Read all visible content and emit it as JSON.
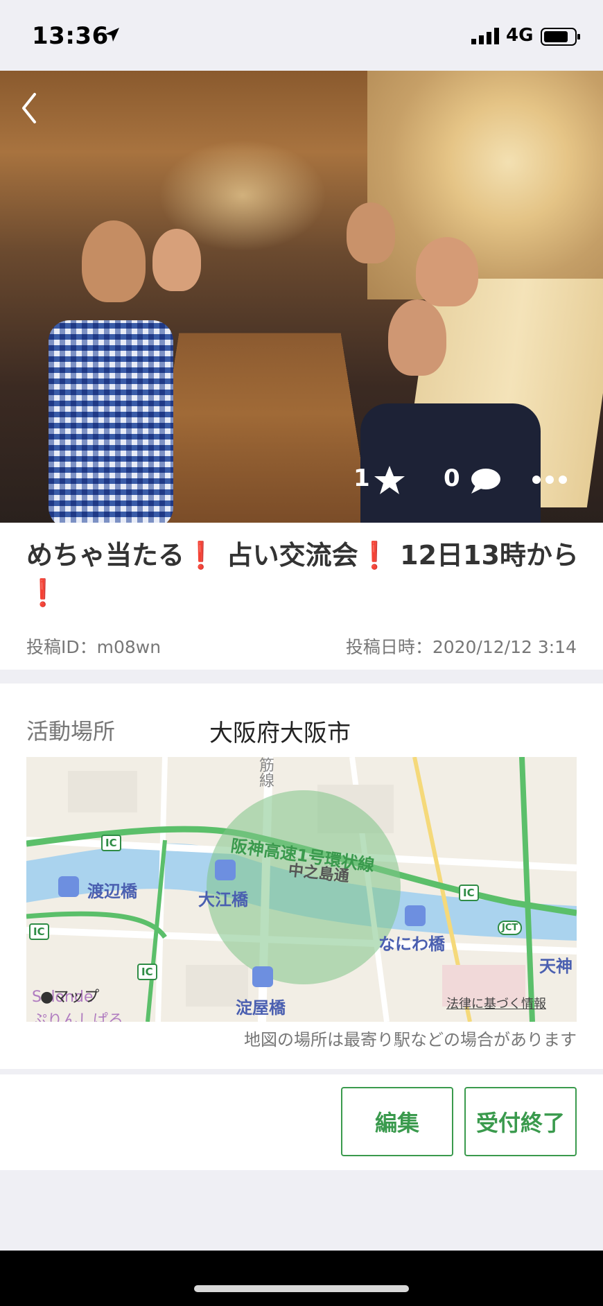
{
  "status": {
    "time": "13:36",
    "network": "4G"
  },
  "post": {
    "title_parts": [
      "めちゃ当たる",
      "❗",
      " 占い交流会",
      "❗",
      " 12日13時から",
      "❗"
    ],
    "likes": "1",
    "comments": "0",
    "id_label": "投稿ID：m08wn",
    "date_label": "投稿日時：2020/12/12 3:14"
  },
  "location": {
    "label": "活動場所",
    "value": "大阪府大阪市",
    "note": "地図の場所は最寄り駅などの場合があります",
    "map": {
      "highway": "阪神高速1号環状線",
      "street": "中之島通",
      "stations": [
        "渡辺橋",
        "大江橋",
        "なにわ橋",
        "淀屋橋"
      ],
      "line": "筋線",
      "district": "天神",
      "maps_label": "マップ",
      "legal": "法律に基づく情報",
      "shop": "Salonde",
      "shop_sub": "ぷりんしぱる",
      "ic": "IC",
      "jct": "JCT"
    }
  },
  "actions": {
    "edit": "編集",
    "close": "受付終了"
  },
  "colors": {
    "accent_green": "#3a9a4d",
    "alert_red": "#e02b2b"
  }
}
